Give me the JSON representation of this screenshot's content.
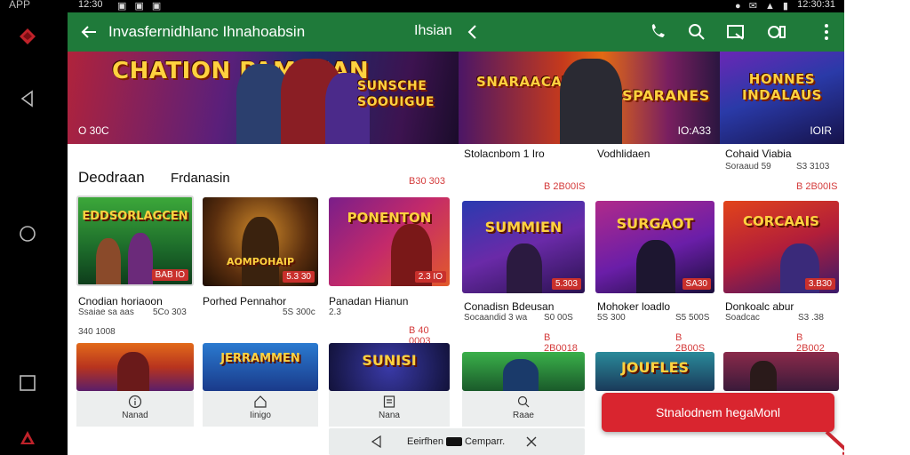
{
  "system": {
    "app_label": "APP",
    "status_time_left": "12:30",
    "status_time_right": "12:30:31"
  },
  "toolbar": {
    "title": "Invasfernidhlanc Ihnahoabsin",
    "subtitle": "Ihsian"
  },
  "banners": [
    {
      "title": "CHATION PAMAEAN",
      "subtitle": "SUNSCHE SOOUIGUE",
      "badge": "O 30C"
    },
    {
      "title": "SNARAACAUI FIA",
      "subtitle": "SPARANES",
      "badge": "IO:A33"
    },
    {
      "title": "HONNES INDALAUS",
      "badge": "IOIR"
    }
  ],
  "section": {
    "title": "Deodraan",
    "tab": "Frdanasin",
    "price_tag": "B30 303"
  },
  "columns_right_header": [
    {
      "label": "Stolacnbom 1 Iro",
      "meta": ""
    },
    {
      "label": "Vodhlidaen",
      "meta": ""
    },
    {
      "label": "Cohaid Viabia",
      "meta": "Soraaud 59",
      "price": "S3 3103"
    }
  ],
  "right_prices_top": [
    "B 2B00IS",
    "B 2B00IS"
  ],
  "cards_row1": [
    {
      "thumb_title": "EDDSORLAGCEN",
      "badge": "BAB IO",
      "name": "Cnodian horiaoon",
      "meta": "Ssaiae sa aas",
      "meta_right": "5Co 303",
      "price": "340 1008"
    },
    {
      "thumb_title": "AOMPOHAIP",
      "badge": "5.3 30",
      "name": "Porhed Pennahor",
      "meta": "",
      "meta_right": "5S 300c",
      "price": ""
    },
    {
      "thumb_title": "PONENTON",
      "badge": "2.3 IO",
      "name": "Panadan Hianun",
      "meta": "2.3",
      "meta_right": "",
      "price": "B 40 0003"
    },
    {
      "thumb_title": "SUMMIEN",
      "badge": "5.303",
      "name": "Conadisn Bdeusan",
      "meta": "Socaandid 3 wa",
      "meta_right": "S0 00S",
      "price": "B 2B0018"
    },
    {
      "thumb_title": "SURGAOT",
      "badge": "SA30",
      "name": "Mohoker loadlo",
      "meta": "5S 300",
      "meta_right": "S5 500S",
      "price": "B 2B00S"
    },
    {
      "thumb_title": "CORCAAIS",
      "badge": "3.B30",
      "name": "Donkoalc abur",
      "meta": "Soadcac",
      "meta_right": "S3 .38",
      "price": "B 2B002"
    }
  ],
  "cards_row2": [
    {
      "thumb_title": ""
    },
    {
      "thumb_title": "JERRAMMEN"
    },
    {
      "thumb_title": "SUNISI"
    },
    {
      "thumb_title": ""
    },
    {
      "thumb_title": "JOUFLES"
    },
    {
      "thumb_title": ""
    }
  ],
  "actions": [
    {
      "label": "Nanad",
      "icon": "info-icon"
    },
    {
      "label": "Iinigo",
      "icon": "home-icon"
    },
    {
      "label": "Nana",
      "icon": "document-icon"
    },
    {
      "label": "Raae",
      "icon": "search-icon"
    }
  ],
  "bottom_bar": {
    "text_left": "Eeirfhen",
    "text_right": "Cemparr."
  },
  "cta": {
    "label": "Stnalodnem hegaMonl"
  },
  "colors": {
    "toolbar": "#1f7a3a",
    "accent_red": "#d9252f",
    "price_red": "#d43a3a"
  }
}
